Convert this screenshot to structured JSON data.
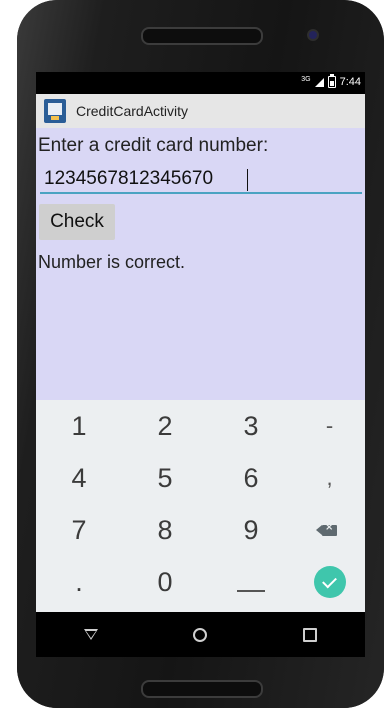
{
  "status_bar": {
    "network": "3G",
    "time": "7:44"
  },
  "action_bar": {
    "title": "CreditCardActivity"
  },
  "main": {
    "prompt": "Enter a credit card number:",
    "card_input_value": "1234567812345670",
    "check_button_label": "Check",
    "result_text": "Number is correct."
  },
  "keyboard": {
    "rows": [
      [
        "1",
        "2",
        "3",
        "-"
      ],
      [
        "4",
        "5",
        "6",
        ","
      ],
      [
        "7",
        "8",
        "9",
        "backspace-icon"
      ],
      [
        ".",
        "0",
        "_",
        "done-icon"
      ]
    ],
    "accent_color": "#3fc6ac"
  },
  "nav_bar": {
    "icons": [
      "back-icon",
      "home-icon",
      "recent-apps-icon"
    ]
  }
}
